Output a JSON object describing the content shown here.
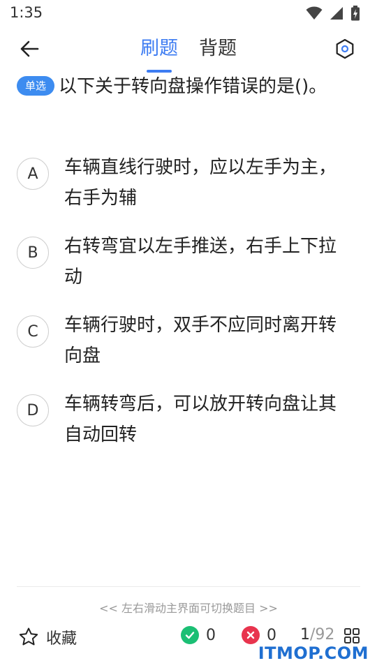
{
  "status_bar": {
    "time": "1:35"
  },
  "header": {
    "tabs": [
      {
        "label": "刷题",
        "active": true
      },
      {
        "label": "背题",
        "active": false
      }
    ]
  },
  "question": {
    "type_badge": "单选",
    "text": "以下关于转向盘操作错误的是()。"
  },
  "options": [
    {
      "letter": "A",
      "text": "车辆直线行驶时，应以左手为主，右手为辅"
    },
    {
      "letter": "B",
      "text": "右转弯宜以左手推送，右手上下拉动"
    },
    {
      "letter": "C",
      "text": "车辆行驶时，双手不应同时离开转向盘"
    },
    {
      "letter": "D",
      "text": "车辆转弯后，可以放开转向盘让其自动回转"
    }
  ],
  "footer": {
    "swipe_hint": "<< 左右滑动主界面可切换题目 >>",
    "favorite_label": "收藏",
    "correct_count": "0",
    "wrong_count": "0",
    "current_index": "1",
    "total": "/92"
  },
  "watermark": "ITMOP.COM",
  "colors": {
    "accent": "#3d7cf2",
    "badge": "#3d8cf0",
    "correct": "#1bbf74",
    "wrong": "#e8344e",
    "watermark": "#1f6fd1"
  },
  "icons": {
    "back": "arrow-left-icon",
    "settings": "hexagon-settings-icon",
    "favorite": "star-outline-icon",
    "correct": "check-circle-icon",
    "wrong": "x-circle-icon",
    "grid": "grid-icon"
  }
}
